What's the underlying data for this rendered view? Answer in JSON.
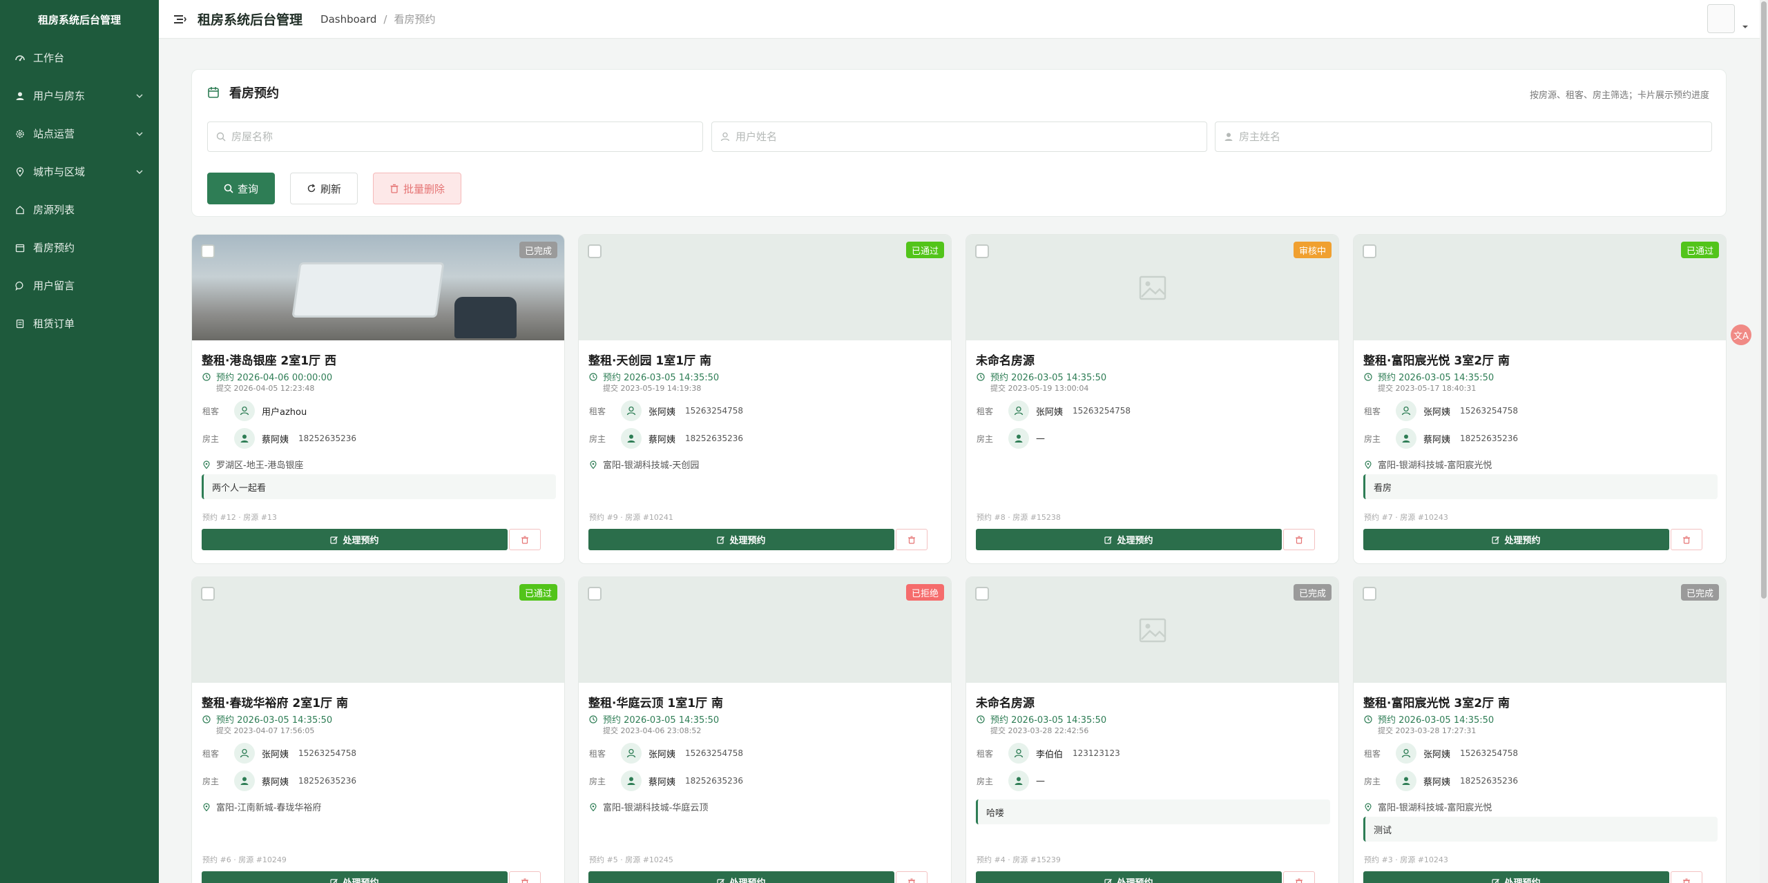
{
  "sidebar": {
    "brand": "租房系统后台管理",
    "items": [
      {
        "label": "工作台",
        "icon": "dashboard-icon"
      },
      {
        "label": "用户与房东",
        "icon": "user-icon",
        "expandable": true
      },
      {
        "label": "站点运营",
        "icon": "gear-icon",
        "expandable": true
      },
      {
        "label": "城市与区域",
        "icon": "location-icon",
        "expandable": true
      },
      {
        "label": "房源列表",
        "icon": "home-icon"
      },
      {
        "label": "看房预约",
        "icon": "calendar-icon"
      },
      {
        "label": "用户留言",
        "icon": "message-icon"
      },
      {
        "label": "租赁订单",
        "icon": "document-icon"
      }
    ]
  },
  "header": {
    "title": "租房系统后台管理",
    "breadcrumb": [
      "Dashboard",
      "看房预约"
    ]
  },
  "panel": {
    "title": "看房预约",
    "hint": "按房源、租客、房主筛选；卡片展示预约进度",
    "search_house_placeholder": "房屋名称",
    "search_user_placeholder": "用户姓名",
    "search_owner_placeholder": "房主姓名",
    "query_label": "查询",
    "refresh_label": "刷新",
    "batch_delete_label": "批量删除"
  },
  "labels": {
    "tenant": "租客",
    "owner": "房主",
    "handle": "处理预约"
  },
  "status_colors": {
    "已完成": "#9a9a9a",
    "已通过": "#52c41a",
    "审核中": "#f0a030",
    "已拒绝": "#f56c6c"
  },
  "cards": [
    {
      "status": "已完成",
      "title": "整租·港岛银座 2室1厅 西",
      "appt": "预约 2026-04-06 00:00:00",
      "submit": "提交 2026-04-05 12:23:48",
      "tenant_name": "用户azhou",
      "tenant_phone": "",
      "owner_name": "蔡阿姨",
      "owner_phone": "18252635236",
      "address": "罗湖区-地王-港岛银座",
      "note": "两个人一起看",
      "meta": "预约 #12 · 房源 #13",
      "image": "photo"
    },
    {
      "status": "已通过",
      "title": "整租·天创园 1室1厅 南",
      "appt": "预约 2026-03-05 14:35:50",
      "submit": "提交 2023-05-19 14:19:38",
      "tenant_name": "张阿姨",
      "tenant_phone": "15263254758",
      "owner_name": "蔡阿姨",
      "owner_phone": "18252635236",
      "address": "富阳-银湖科技城-天创园",
      "note": "",
      "meta": "预约 #9 · 房源 #10241",
      "image": "blank"
    },
    {
      "status": "审核中",
      "title": "未命名房源",
      "appt": "预约 2026-03-05 14:35:50",
      "submit": "提交 2023-05-19 13:00:04",
      "tenant_name": "张阿姨",
      "tenant_phone": "15263254758",
      "owner_name": "—",
      "owner_phone": "",
      "address": "",
      "note": "",
      "meta": "预约 #8 · 房源 #15238",
      "image": "placeholder"
    },
    {
      "status": "已通过",
      "title": "整租·富阳宸光悦 3室2厅 南",
      "appt": "预约 2026-03-05 14:35:50",
      "submit": "提交 2023-05-17 18:40:31",
      "tenant_name": "张阿姨",
      "tenant_phone": "15263254758",
      "owner_name": "蔡阿姨",
      "owner_phone": "18252635236",
      "address": "富阳-银湖科技城-富阳宸光悦",
      "note": "看房",
      "meta": "预约 #7 · 房源 #10243",
      "image": "blank"
    },
    {
      "status": "已通过",
      "title": "整租·春珑华裕府 2室1厅 南",
      "appt": "预约 2026-03-05 14:35:50",
      "submit": "提交 2023-04-07 17:56:05",
      "tenant_name": "张阿姨",
      "tenant_phone": "15263254758",
      "owner_name": "蔡阿姨",
      "owner_phone": "18252635236",
      "address": "富阳-江南新城-春珑华裕府",
      "note": "",
      "meta": "预约 #6 · 房源 #10249",
      "image": "blank"
    },
    {
      "status": "已拒绝",
      "title": "整租·华庭云顶 1室1厅 南",
      "appt": "预约 2026-03-05 14:35:50",
      "submit": "提交 2023-04-06 23:08:52",
      "tenant_name": "张阿姨",
      "tenant_phone": "15263254758",
      "owner_name": "蔡阿姨",
      "owner_phone": "18252635236",
      "address": "富阳-银湖科技城-华庭云顶",
      "note": "",
      "meta": "预约 #5 · 房源 #10245",
      "image": "blank"
    },
    {
      "status": "已完成",
      "title": "未命名房源",
      "appt": "预约 2026-03-05 14:35:50",
      "submit": "提交 2023-03-28 22:42:56",
      "tenant_name": "李伯伯",
      "tenant_phone": "123123123",
      "owner_name": "—",
      "owner_phone": "",
      "address": "",
      "note": "哈喽",
      "meta": "预约 #4 · 房源 #15239",
      "image": "placeholder"
    },
    {
      "status": "已完成",
      "title": "整租·富阳宸光悦 3室2厅 南",
      "appt": "预约 2026-03-05 14:35:50",
      "submit": "提交 2023-03-28 17:27:31",
      "tenant_name": "张阿姨",
      "tenant_phone": "15263254758",
      "owner_name": "蔡阿姨",
      "owner_phone": "18252635236",
      "address": "富阳-银湖科技城-富阳宸光悦",
      "note": "测试",
      "meta": "预约 #3 · 房源 #10243",
      "image": "blank"
    }
  ],
  "float_button": "文A"
}
